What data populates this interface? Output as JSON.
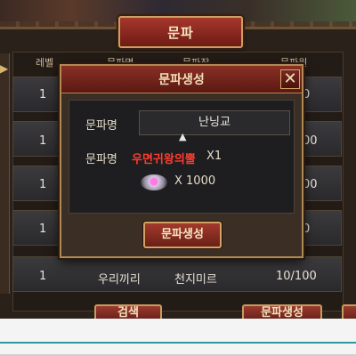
{
  "window": {
    "title": "문파"
  },
  "list": {
    "columns": [
      "레벨",
      "문파명",
      "문파장",
      "문파원"
    ],
    "rows": [
      {
        "level": "1",
        "members_partial": "0"
      },
      {
        "level": "1",
        "members_partial": "00"
      },
      {
        "level": "1",
        "members_partial": "00"
      },
      {
        "level": "1",
        "members_partial": "0"
      },
      {
        "level": "1",
        "name": "우리끼리",
        "leader": "천지미르",
        "members": "10/100"
      }
    ]
  },
  "bottom_buttons": {
    "search": "검색",
    "create": "문파생성"
  },
  "dialog": {
    "title": "문파생성",
    "close_icon": "close-x",
    "name_label": "문파명",
    "name_value": "난닝교",
    "cost_label": "문파명",
    "cost_item": "우면귀왕의뿔",
    "cost_item_qty": "X1",
    "cost_gem_qty": "X 1000",
    "create_button": "문파생성"
  },
  "colors": {
    "accent_red": "#ff3b2e",
    "gold_border": "#b08a55",
    "button_red": "#8a3025"
  }
}
